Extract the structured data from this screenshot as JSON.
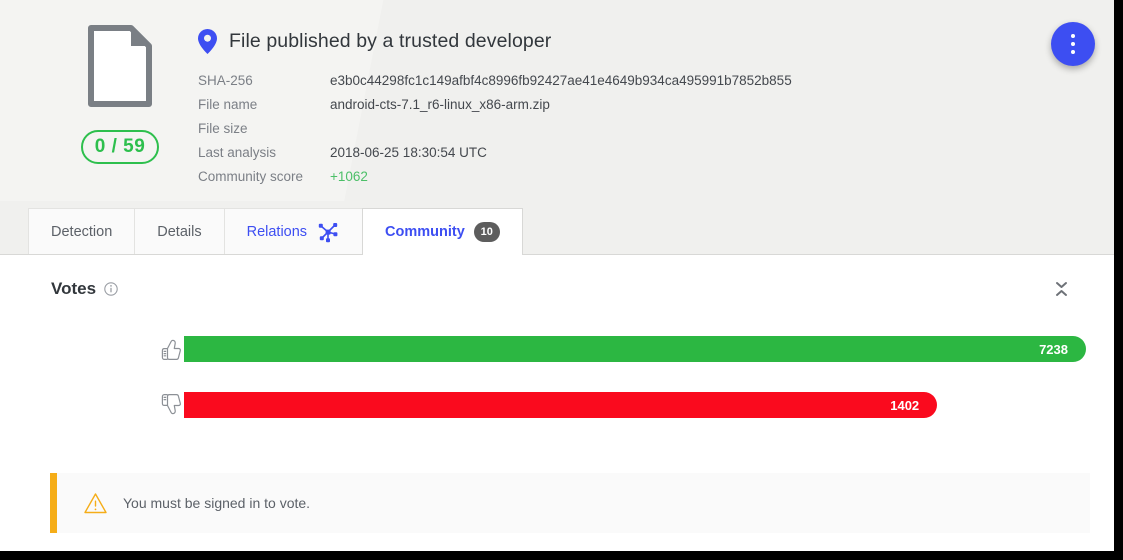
{
  "header": {
    "file_icon": "file-document-icon",
    "score_badge": "0 / 59",
    "verdict_icon": "map-pin-icon",
    "verdict": "File published by a trusted developer",
    "fab_icon": "more-vertical-icon",
    "metadata": [
      {
        "label": "SHA-256",
        "value": "e3b0c44298fc1c149afbf4c8996fb92427ae41e4649b934ca495991b7852b855",
        "accent": false
      },
      {
        "label": "File name",
        "value": "android-cts-7.1_r6-linux_x86-arm.zip",
        "accent": false
      },
      {
        "label": "File size",
        "value": "",
        "accent": false
      },
      {
        "label": "Last analysis",
        "value": "2018-06-25 18:30:54 UTC",
        "accent": false
      },
      {
        "label": "Community score",
        "value": "+1062",
        "accent": true
      }
    ]
  },
  "tabs": [
    {
      "label": "Detection",
      "active": false,
      "link": false,
      "icon": null,
      "badge": null
    },
    {
      "label": "Details",
      "active": false,
      "link": false,
      "icon": null,
      "badge": null
    },
    {
      "label": "Relations",
      "active": false,
      "link": true,
      "icon": "graph-icon",
      "badge": null
    },
    {
      "label": "Community",
      "active": true,
      "link": true,
      "icon": null,
      "badge": "10"
    }
  ],
  "votes": {
    "title": "Votes",
    "info_icon": "info-circle-icon",
    "collapse_icon": "collapse-icon",
    "rows": [
      {
        "label": "Safe",
        "icon": "thumbs-up-icon",
        "count": "7238",
        "kind": "safe"
      },
      {
        "label": "Unsafe",
        "icon": "thumbs-down-icon",
        "count": "1402",
        "kind": "unsafe"
      }
    ]
  },
  "notice": {
    "icon": "warning-triangle-icon",
    "text": "You must be signed in to vote."
  },
  "colors": {
    "accent_blue": "#3d4ef2",
    "safe_green": "#2cb742",
    "unsafe_red": "#fa0a1e",
    "score_green": "#2dbf4d",
    "community_score_green": "#4cbf68",
    "warning_amber": "#f5ad18",
    "badge_gray": "#5d5d5d"
  },
  "chart_data": {
    "type": "bar",
    "title": "Votes",
    "categories": [
      "Safe",
      "Unsafe"
    ],
    "values": [
      7238,
      1402
    ],
    "colors": [
      "#2cb742",
      "#fa0a1e"
    ],
    "xlabel": "",
    "ylabel": "",
    "orientation": "horizontal",
    "grid": false,
    "legend": "none"
  }
}
